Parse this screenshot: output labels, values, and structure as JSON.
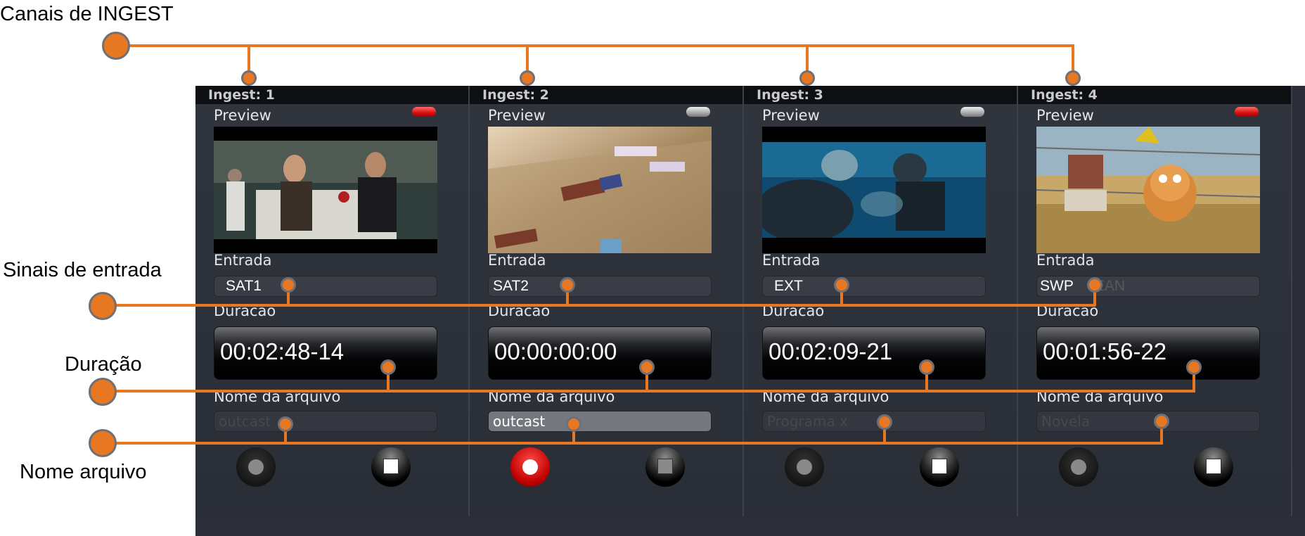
{
  "annotations": {
    "ingest_channels": "Canais de INGEST",
    "input_signals": "Sinais de entrada",
    "duration": "Duração",
    "file_name": "Nome arquivo"
  },
  "labels": {
    "preview": "Preview",
    "input": "Entrada",
    "duration": "Duracao",
    "file_name": "Nome da arquivo"
  },
  "colors": {
    "annotation": "#e87722",
    "led_active": "#d81010",
    "record_active": "#c00000"
  },
  "channels": [
    {
      "header": "Ingest: 1",
      "led": "red",
      "input": "SAT1",
      "input_ghost": "",
      "duration": "00:02:48-14",
      "file_name": "outcast",
      "file_name_active": false,
      "recording": false,
      "preview": "party scene"
    },
    {
      "header": "Ingest: 2",
      "led": "gray",
      "input": "SAT2",
      "input_ghost": "",
      "duration": "00:00:00:00",
      "file_name": "outcast",
      "file_name_active": true,
      "recording": true,
      "preview": "table board scene"
    },
    {
      "header": "Ingest: 3",
      "led": "gray",
      "input": "EXT",
      "input_ghost": "",
      "duration": "00:02:09-21",
      "file_name": "Programa x",
      "file_name_active": false,
      "recording": false,
      "preview": "underwater divers"
    },
    {
      "header": "Ingest: 4",
      "led": "red",
      "input": "SWP",
      "input_ghost": "EAN",
      "duration": "00:01:56-22",
      "file_name": "Novela",
      "file_name_active": false,
      "recording": false,
      "preview": "cartoon animal field"
    }
  ]
}
